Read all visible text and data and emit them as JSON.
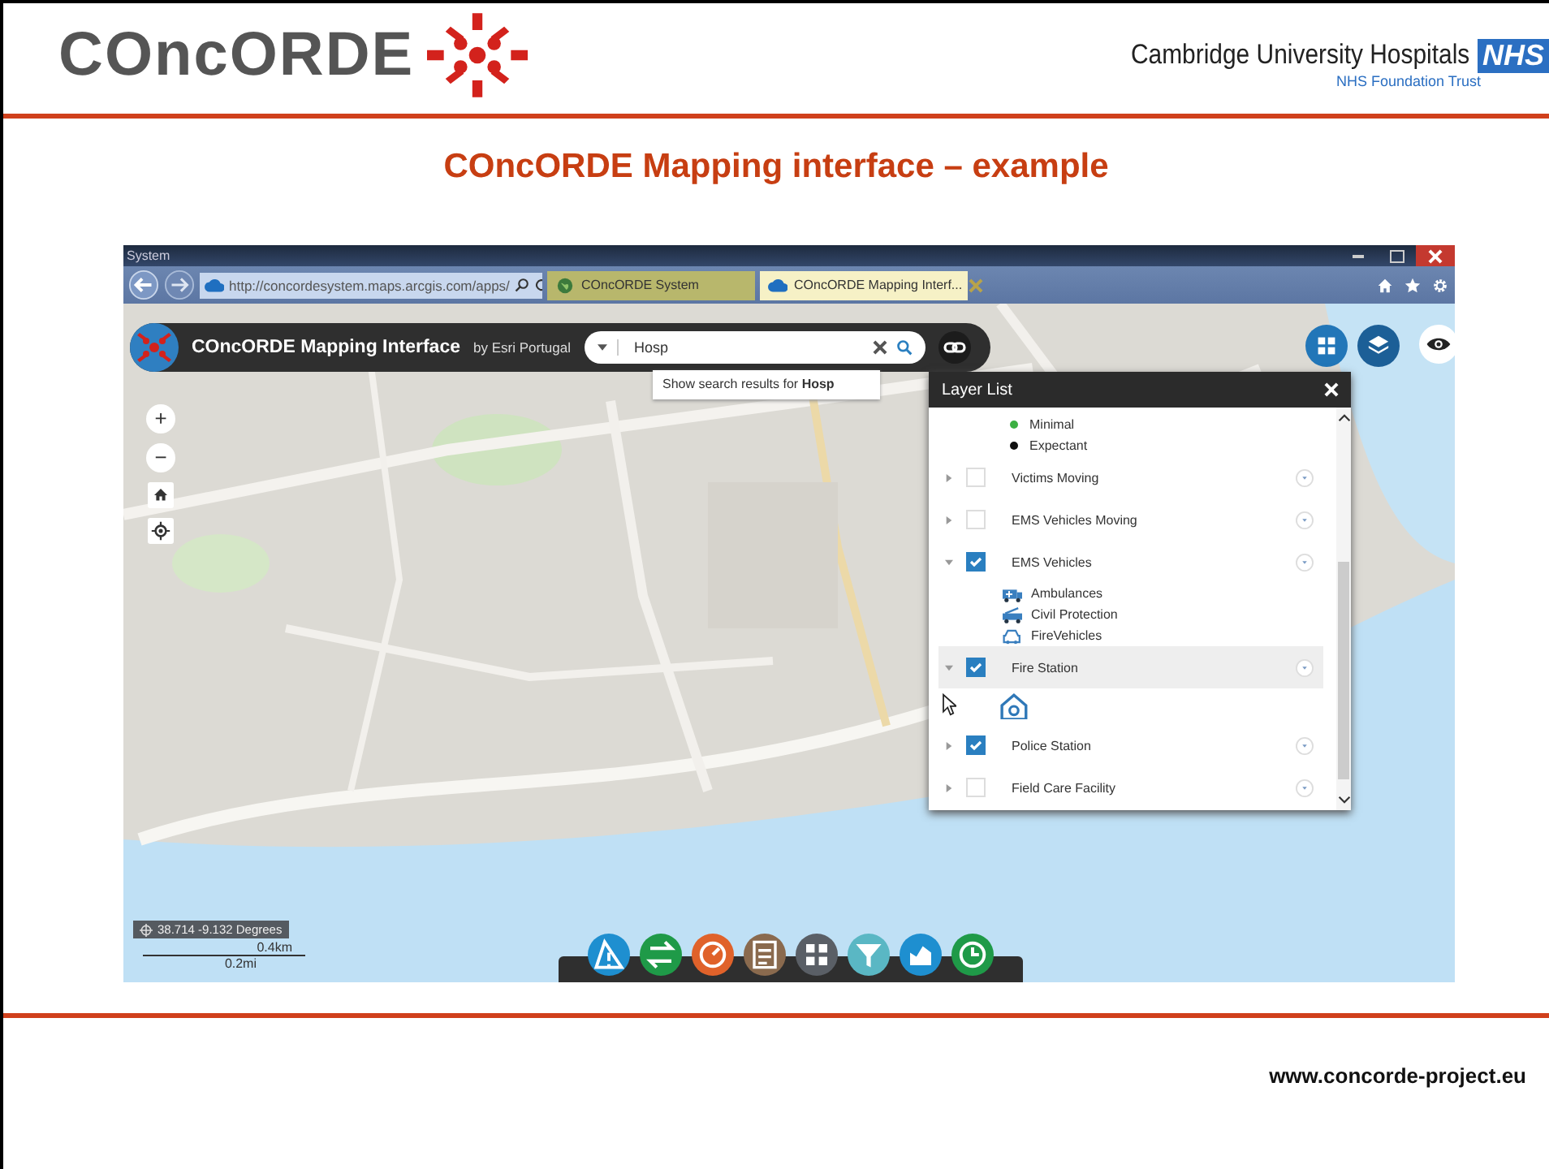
{
  "header": {
    "logo_text": "COncORDE",
    "partner": "Cambridge University Hospitals",
    "partner_badge": "NHS",
    "partner_sub": "NHS Foundation Trust"
  },
  "slide_title": "COncORDE Mapping interface – example",
  "browser": {
    "window_title": "System",
    "address": "http://concordesystem.maps.arcgis.com/apps/",
    "tabs": [
      {
        "label": "COncORDE System",
        "selected": false
      },
      {
        "label": "COncORDE Mapping Interf...",
        "selected": true
      }
    ]
  },
  "app": {
    "title": "COncORDE Mapping Interface",
    "byline": "by Esri Portugal",
    "search": {
      "value": "Hosp"
    },
    "suggestion": "Show search results for **Hosp**"
  },
  "layer_list": {
    "title": "Layer List",
    "legend": [
      {
        "label": "Minimal",
        "color": "#3cb043"
      },
      {
        "label": "Expectant",
        "color": "#111111"
      }
    ],
    "layers": [
      {
        "name": "Victims Moving",
        "checked": false,
        "expanded": false,
        "selected": false
      },
      {
        "name": "EMS Vehicles Moving",
        "checked": false,
        "expanded": false,
        "selected": false
      },
      {
        "name": "EMS Vehicles",
        "checked": true,
        "expanded": true,
        "selected": false,
        "children": [
          {
            "label": "Ambulances",
            "kind": "ambulance"
          },
          {
            "label": "Civil Protection",
            "kind": "truck"
          },
          {
            "label": "FireVehicles",
            "kind": "car"
          }
        ]
      },
      {
        "name": "Fire Station",
        "checked": true,
        "expanded": true,
        "selected": true,
        "children": [
          {
            "kind": "station"
          }
        ]
      },
      {
        "name": "Police Station",
        "checked": true,
        "expanded": false,
        "selected": false
      },
      {
        "name": "Field Care Facility",
        "checked": false,
        "expanded": false,
        "selected": false
      }
    ]
  },
  "map": {
    "zoom_in": "+",
    "zoom_out": "−",
    "coordinates": "38.714 -9.132 Degrees",
    "scale_km": "0.4km",
    "scale_mi": "0.2mi"
  },
  "tools": [
    {
      "kind": "alert",
      "color": "#1e8fd0"
    },
    {
      "kind": "swap",
      "color": "#1f9a48"
    },
    {
      "kind": "gauge",
      "color": "#e0622a"
    },
    {
      "kind": "note",
      "color": "#8a6a4e"
    },
    {
      "kind": "grid",
      "color": "#5a5f66"
    },
    {
      "kind": "filter",
      "color": "#5ab7c4"
    },
    {
      "kind": "chart",
      "color": "#1e8fd0"
    },
    {
      "kind": "clock",
      "color": "#1f9a48"
    }
  ],
  "footer": {
    "url": "www.concorde-project.eu"
  }
}
